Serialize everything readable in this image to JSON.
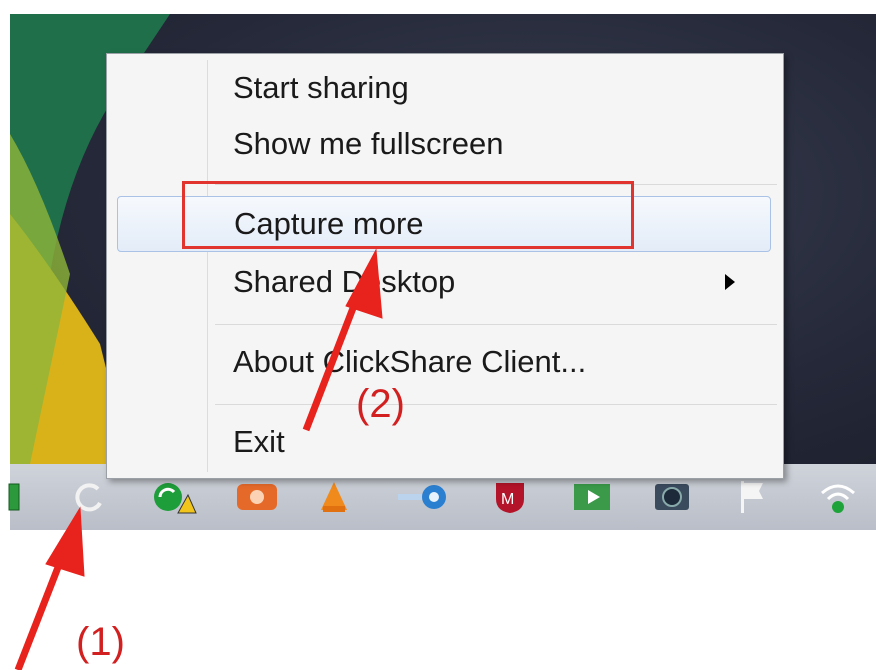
{
  "context_menu": {
    "items": [
      {
        "label": "Start sharing"
      },
      {
        "label": "Show me fullscreen"
      },
      {
        "label": "Capture more"
      },
      {
        "label": "Shared Desktop"
      },
      {
        "label": "About ClickShare Client..."
      },
      {
        "label": "Exit"
      }
    ]
  },
  "annotations": {
    "callout_1": "(1)",
    "callout_2": "(2)",
    "color": "#e2342f"
  },
  "tray": {
    "icons": [
      "battery-icon",
      "clickshare-icon",
      "sync-warning-icon",
      "app-orange-icon",
      "vlc-icon",
      "network-app-icon",
      "mcafee-icon",
      "media-icon",
      "camera-icon",
      "flag-icon",
      "wifi-icon"
    ]
  }
}
